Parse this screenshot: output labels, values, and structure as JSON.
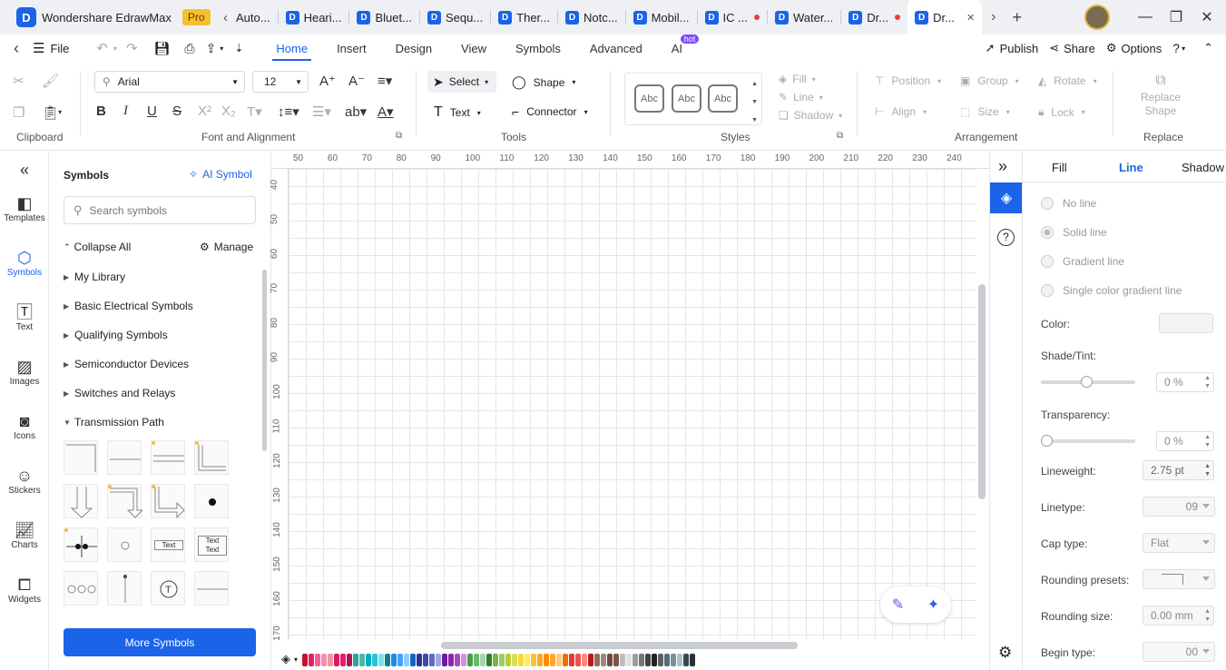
{
  "app": {
    "name": "Wondershare EdrawMax",
    "badge": "Pro"
  },
  "tabs": [
    {
      "label": "Auto...",
      "dot": false,
      "icon": false
    },
    {
      "label": "Heari...",
      "dot": false,
      "icon": true
    },
    {
      "label": "Bluet...",
      "dot": false,
      "icon": true
    },
    {
      "label": "Sequ...",
      "dot": false,
      "icon": true
    },
    {
      "label": "Ther...",
      "dot": false,
      "icon": true
    },
    {
      "label": "Notc...",
      "dot": false,
      "icon": true
    },
    {
      "label": "Mobil...",
      "dot": false,
      "icon": true
    },
    {
      "label": "IC ...",
      "dot": true,
      "icon": true
    },
    {
      "label": "Water...",
      "dot": false,
      "icon": true
    },
    {
      "label": "Dr...",
      "dot": true,
      "icon": true
    },
    {
      "label": "Dr...",
      "dot": false,
      "icon": true,
      "active": true
    }
  ],
  "menu": {
    "file": "File",
    "tabs": [
      "Home",
      "Insert",
      "Design",
      "View",
      "Symbols",
      "Advanced",
      "AI"
    ],
    "ai_badge": "hot",
    "publish": "Publish",
    "share": "Share",
    "options": "Options"
  },
  "ribbon": {
    "font_name": "Arial",
    "font_size": "12",
    "select": "Select",
    "shape": "Shape",
    "text": "Text",
    "connector": "Connector",
    "style_sample": "Abc",
    "fill": "Fill",
    "line": "Line",
    "shadow": "Shadow",
    "position": "Position",
    "group": "Group",
    "rotate": "Rotate",
    "align": "Align",
    "size": "Size",
    "lock": "Lock",
    "replace_shape": "Replace Shape",
    "groups": {
      "clipboard": "Clipboard",
      "font": "Font and Alignment",
      "tools": "Tools",
      "styles": "Styles",
      "arrangement": "Arrangement",
      "replace": "Replace"
    }
  },
  "rail": [
    "Templates",
    "Symbols",
    "Text",
    "Images",
    "Icons",
    "Stickers",
    "Charts",
    "Widgets"
  ],
  "symbols": {
    "title": "Symbols",
    "ai_symbol": "AI Symbol",
    "search_placeholder": "Search symbols",
    "collapse_all": "Collapse All",
    "manage": "Manage",
    "categories": [
      "My Library",
      "Basic Electrical Symbols",
      "Qualifying Symbols",
      "Semiconductor Devices",
      "Switches and Relays",
      "Transmission Path"
    ],
    "text_sample": "Text",
    "more_button": "More Symbols"
  },
  "ruler": {
    "top": [
      "50",
      "60",
      "70",
      "80",
      "90",
      "100",
      "110",
      "120",
      "130",
      "140",
      "150",
      "160",
      "170",
      "180",
      "190",
      "200",
      "210",
      "220",
      "230",
      "240"
    ],
    "left": [
      "40",
      "50",
      "60",
      "70",
      "80",
      "90",
      "100",
      "110",
      "120",
      "130",
      "140",
      "150",
      "160",
      "170"
    ]
  },
  "palette": [
    "#c8102e",
    "#e0245e",
    "#f06292",
    "#f48fb1",
    "#ef9a9a",
    "#d81b60",
    "#e91e63",
    "#ad1457",
    "#26a69a",
    "#4db6ac",
    "#00acc1",
    "#26c6da",
    "#80deea",
    "#00838f",
    "#1e88e5",
    "#42a5f5",
    "#90caf9",
    "#1565c0",
    "#283593",
    "#3949ab",
    "#5c6bc0",
    "#9fa8da",
    "#6a1b9a",
    "#8e24aa",
    "#ab47bc",
    "#ce93d8",
    "#43a047",
    "#66bb6a",
    "#a5d6a7",
    "#2e7d32",
    "#7cb342",
    "#9ccc65",
    "#c0ca33",
    "#d4e157",
    "#fdd835",
    "#ffee58",
    "#fbc02d",
    "#f9a825",
    "#fb8c00",
    "#ffa726",
    "#ffcc80",
    "#ef6c00",
    "#e53935",
    "#ef5350",
    "#ff8a80",
    "#b71c1c",
    "#8d6e63",
    "#a1887f",
    "#6d4c41",
    "#795548",
    "#bdbdbd",
    "#e0e0e0",
    "#9e9e9e",
    "#757575",
    "#424242",
    "#212121",
    "#616161",
    "#546e7a",
    "#78909c",
    "#b0bec5",
    "#37474f",
    "#263238"
  ],
  "right_panel": {
    "tabs": [
      "Fill",
      "Line",
      "Shadow"
    ],
    "line_options": [
      "No line",
      "Solid line",
      "Gradient line",
      "Single color gradient line"
    ],
    "color_label": "Color:",
    "shade_label": "Shade/Tint:",
    "shade_value": "0 %",
    "shade_level": 0.45,
    "transparency_label": "Transparency:",
    "transparency_value": "0 %",
    "transparency_level": 0,
    "lineweight_label": "Lineweight:",
    "lineweight_value": "2.75 pt",
    "linetype_label": "Linetype:",
    "linetype_value": "09",
    "cap_label": "Cap type:",
    "cap_value": "Flat",
    "rounding_presets_label": "Rounding presets:",
    "rounding_size_label": "Rounding size:",
    "rounding_size_value": "0.00 mm",
    "begin_type_label": "Begin type:",
    "begin_type_value": "00"
  }
}
